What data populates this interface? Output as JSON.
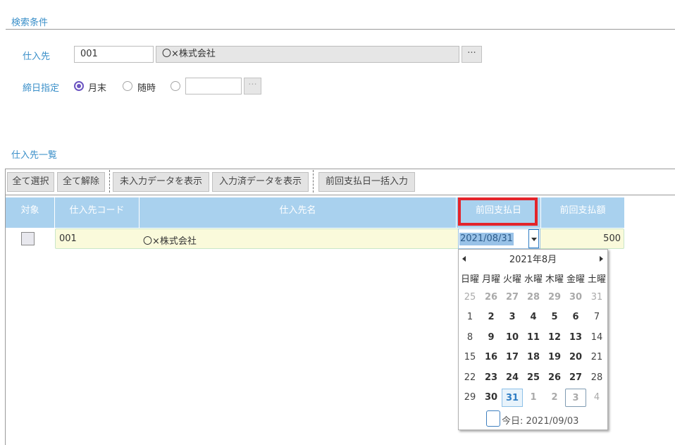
{
  "search": {
    "title": "検索条件",
    "supplier_label": "仕入先",
    "supplier_code": "001",
    "supplier_name": "〇×株式会社",
    "ellipsis": "···",
    "closing_label": "締日指定",
    "radio_month_end": "月末",
    "radio_anytime": "随時"
  },
  "list": {
    "title": "仕入先一覧",
    "toolbar": [
      "全て選択",
      "全て解除",
      "未入力データを表示",
      "入力済データを表示",
      "前回支払日一括入力"
    ],
    "columns": [
      "対象",
      "仕入先コード",
      "仕入先名",
      "前回支払日",
      "前回支払額"
    ],
    "rows": [
      {
        "checked": false,
        "code": "001",
        "name": "〇×株式会社",
        "last_pay_date": "2021/08/31",
        "last_pay_amount": "500"
      }
    ]
  },
  "calendar": {
    "month_label": "2021年8月",
    "weekdays": [
      "日曜",
      "月曜",
      "火曜",
      "水曜",
      "木曜",
      "金曜",
      "土曜"
    ],
    "weeks": [
      [
        "25",
        "26",
        "27",
        "28",
        "29",
        "30",
        "31"
      ],
      [
        "1",
        "2",
        "3",
        "4",
        "5",
        "6",
        "7"
      ],
      [
        "8",
        "9",
        "10",
        "11",
        "12",
        "13",
        "14"
      ],
      [
        "15",
        "16",
        "17",
        "18",
        "19",
        "20",
        "21"
      ],
      [
        "22",
        "23",
        "24",
        "25",
        "26",
        "27",
        "28"
      ],
      [
        "29",
        "30",
        "31",
        "1",
        "2",
        "3",
        "4"
      ]
    ],
    "selected_day": "31",
    "today_label": "今日: 2021/09/03"
  }
}
